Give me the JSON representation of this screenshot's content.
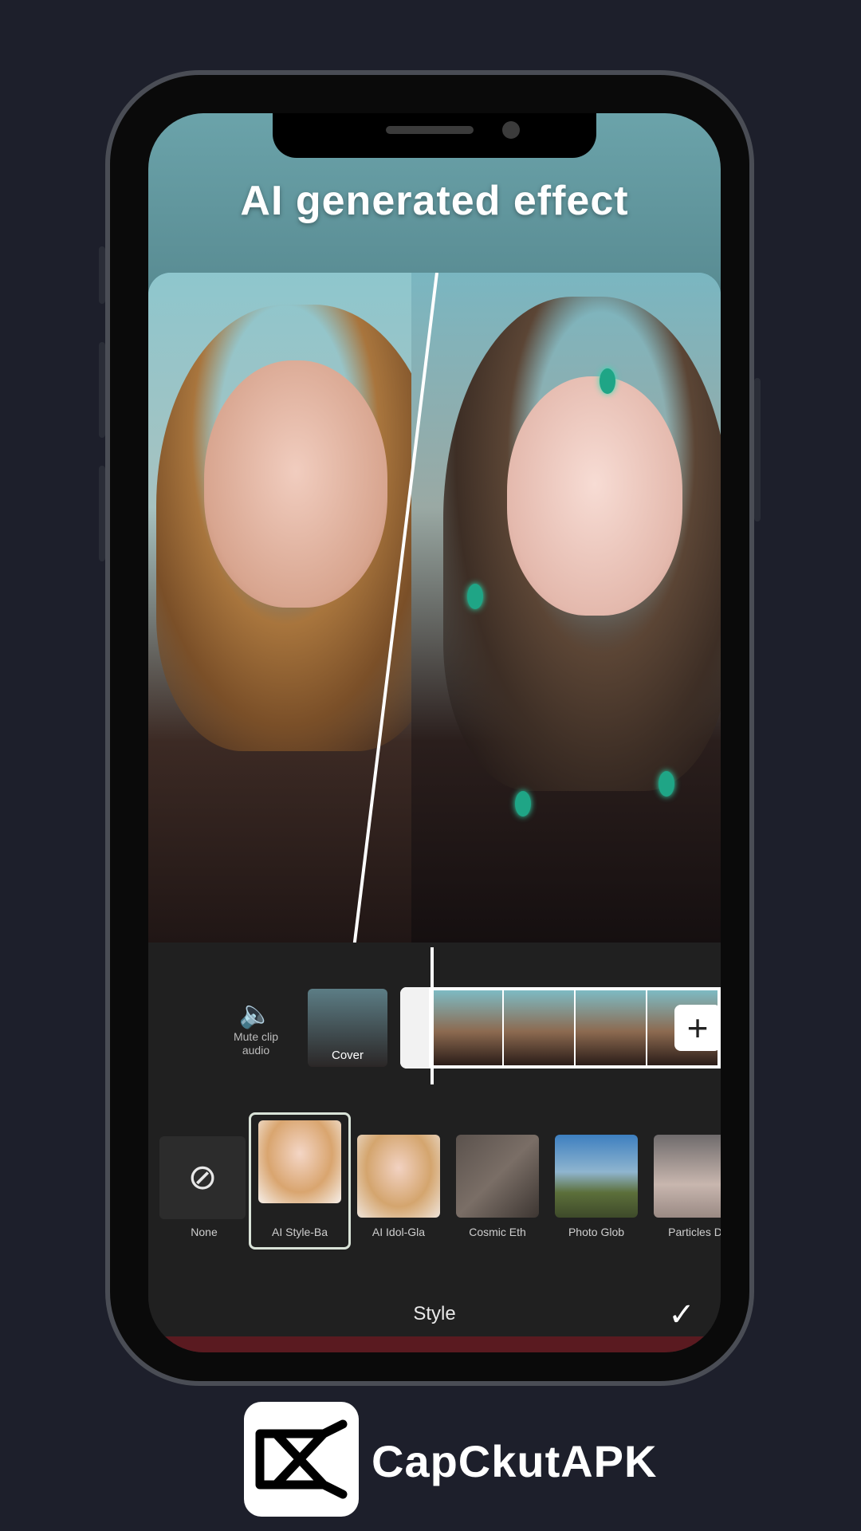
{
  "promo": {
    "headline": "AI generated effect"
  },
  "timeline": {
    "mute_label": "Mute clip audio",
    "cover_label": "Cover",
    "add_label": "+"
  },
  "styles": {
    "items": [
      {
        "label": "None",
        "icon": "no-style-icon"
      },
      {
        "label": "AI Style-Ba",
        "selected": true
      },
      {
        "label": "AI Idol-Gla"
      },
      {
        "label": "Cosmic Eth"
      },
      {
        "label": "Photo Glob"
      },
      {
        "label": "Particles D"
      }
    ]
  },
  "bottom_bar": {
    "title": "Style",
    "confirm_icon": "checkmark-icon"
  },
  "brand": {
    "name": "CapCkutAPK"
  },
  "colors": {
    "background": "#1d1f2b",
    "phone_frame": "#4a4d55",
    "editor_bg": "#202020"
  }
}
